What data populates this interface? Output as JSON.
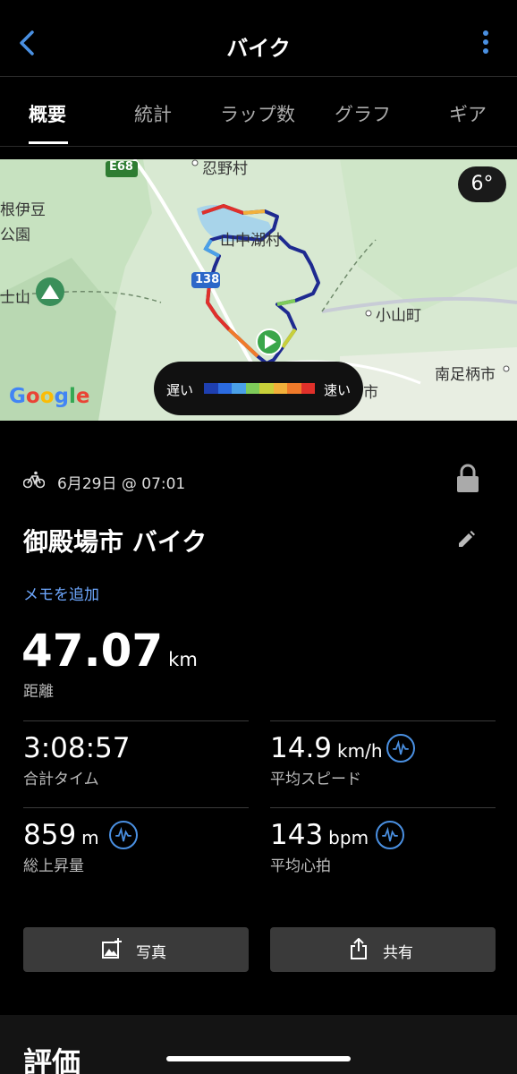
{
  "header": {
    "title": "バイク"
  },
  "tabs": [
    {
      "label": "概要"
    },
    {
      "label": "統計"
    },
    {
      "label": "ラップ数"
    },
    {
      "label": "グラフ"
    },
    {
      "label": "ギア"
    }
  ],
  "map": {
    "labels": [
      "E68",
      "忍野村",
      "根伊豆",
      "公園",
      "士山",
      "山中湖村",
      "138",
      "小山町",
      "南足柄市",
      "市"
    ],
    "temperature": "6°",
    "legend_slow": "遅い",
    "legend_fast": "速い",
    "legend_colors": [
      "#1e3fb0",
      "#2b6be0",
      "#4aa0e8",
      "#7ecb5a",
      "#c8d03a",
      "#f2b03a",
      "#f07a2a",
      "#e0302a"
    ],
    "attribution": "Google"
  },
  "activity": {
    "date": "6月29日 @ 07:01",
    "title": "御殿場市 バイク",
    "add_memo": "メモを追加",
    "distance_value": "47.07",
    "distance_unit": "km",
    "distance_label": "距離"
  },
  "stats": [
    {
      "value": "3:08:57",
      "unit": "",
      "label": "合計タイム"
    },
    {
      "value": "14.9",
      "unit": "km/h",
      "label": "平均スピード"
    },
    {
      "value": "859",
      "unit": "m",
      "label": "総上昇量"
    },
    {
      "value": "143",
      "unit": "bpm",
      "label": "平均心拍"
    }
  ],
  "buttons": {
    "photo": "写真",
    "share": "共有"
  },
  "section": {
    "rating": "評価"
  },
  "colors": {
    "accent": "#4a90e2",
    "link": "#6ea8ff"
  }
}
